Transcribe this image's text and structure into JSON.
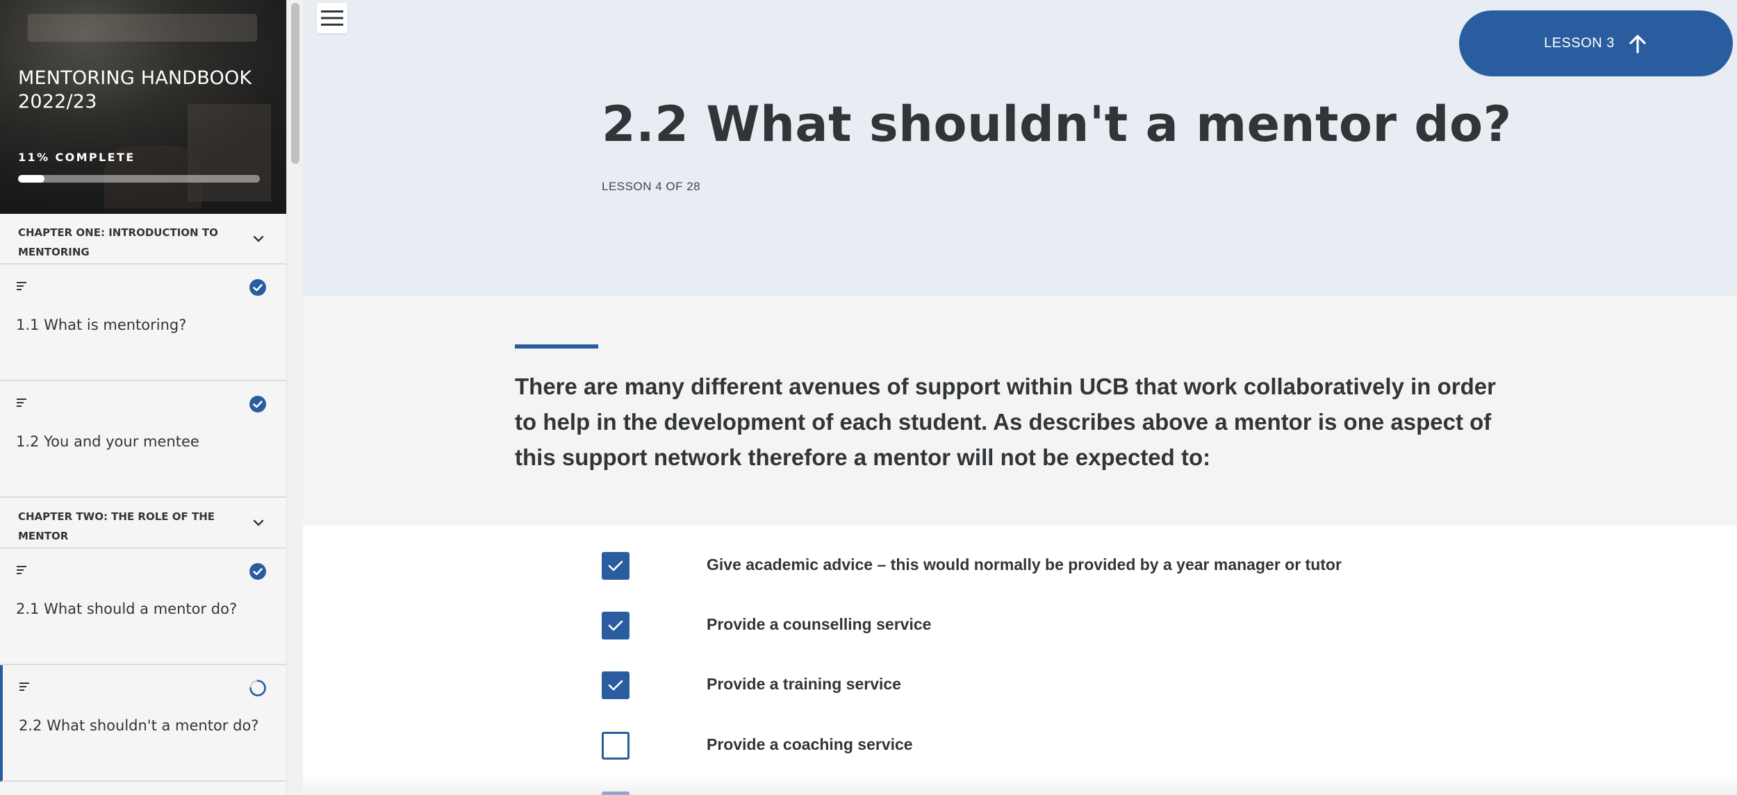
{
  "sidebar": {
    "course_title": "MENTORING HANDBOOK 2022/23",
    "progress_label": "11% COMPLETE",
    "progress_fraction": 0.11,
    "chapters": [
      {
        "title": "CHAPTER ONE: INTRODUCTION TO MENTORING",
        "lessons": [
          {
            "label": "1.1 What is mentoring?",
            "status": "complete"
          },
          {
            "label": "1.2 You and your mentee",
            "status": "complete"
          }
        ]
      },
      {
        "title": "CHAPTER TWO: THE ROLE OF THE MENTOR",
        "lessons": [
          {
            "label": "2.1 What should a mentor do?",
            "status": "complete"
          },
          {
            "label": "2.2 What shouldn't a mentor do?",
            "status": "in-progress"
          }
        ]
      }
    ]
  },
  "header": {
    "menu_icon": "hamburger-icon",
    "lesson_nav_label": "LESSON 3",
    "lesson_nav_icon": "arrow-up-icon"
  },
  "main": {
    "title": "2.2 What shouldn't a mentor do?",
    "lesson_count": "LESSON 4 OF 28",
    "intro": "There are many different avenues of support within UCB that work collaboratively in order to help in the development of each student. As describes above a mentor is one aspect of this support network therefore a mentor will not be expected to:",
    "checklist": [
      {
        "label": "Give academic advice – this would normally be provided by a year manager or tutor",
        "checked": true
      },
      {
        "label": "Provide a counselling service",
        "checked": true
      },
      {
        "label": "Provide a training service",
        "checked": true
      },
      {
        "label": "Provide a coaching service",
        "checked": false
      }
    ]
  },
  "colors": {
    "accent": "#2a5d9f",
    "hero_bg": "#e8edf4",
    "text": "#313537"
  }
}
